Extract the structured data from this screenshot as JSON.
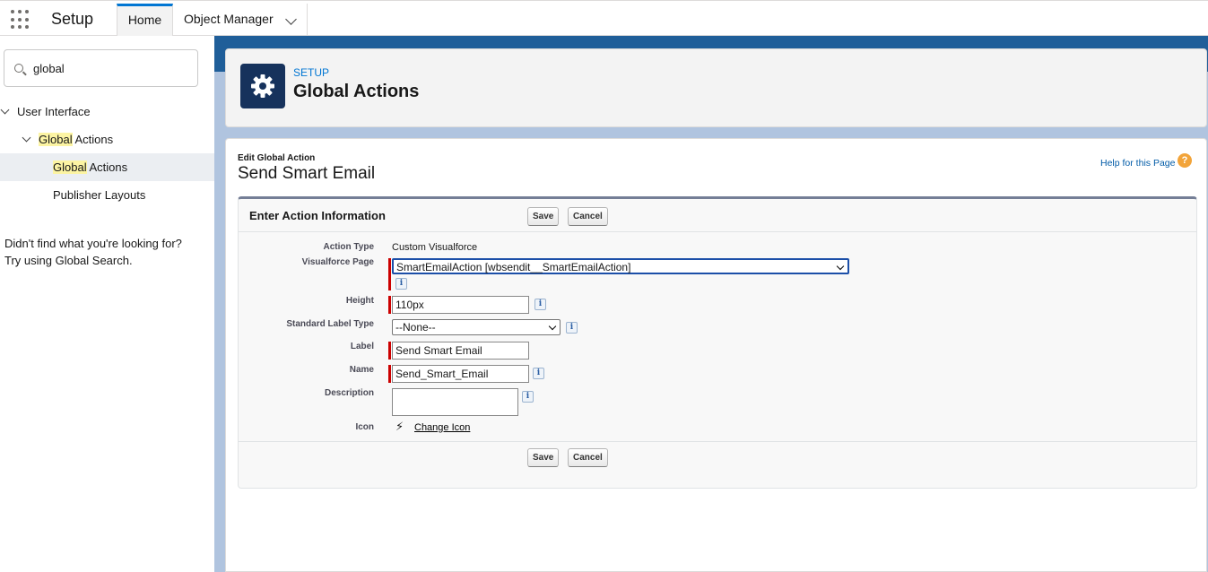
{
  "nav": {
    "app_name": "Setup",
    "tabs": [
      {
        "label": "Home"
      },
      {
        "label": "Object Manager"
      }
    ]
  },
  "sidebar": {
    "search_value": "global",
    "tree": {
      "user_interface": "User Interface",
      "global_actions_parent_hl": "Global",
      "global_actions_parent_rest": " Actions",
      "global_actions_child_hl": "Global",
      "global_actions_child_rest": " Actions",
      "publisher_layouts": "Publisher Layouts"
    },
    "not_found_line1": "Didn't find what you're looking for?",
    "not_found_line2": "Try using Global Search."
  },
  "header": {
    "breadcrumb": "SETUP",
    "title": "Global Actions"
  },
  "form": {
    "subtitle": "Edit Global Action",
    "title": "Send Smart Email",
    "help_link": "Help for this Page",
    "help_icon": "?",
    "section_title": "Enter Action Information",
    "save_label": "Save",
    "cancel_label": "Cancel",
    "fields": {
      "action_type_label": "Action Type",
      "action_type_value": "Custom Visualforce",
      "visualforce_label": "Visualforce Page",
      "visualforce_value": "SmartEmailAction [wbsendit__SmartEmailAction]",
      "height_label": "Height",
      "height_value": "110px",
      "std_label_type_label": "Standard Label Type",
      "std_label_type_value": "--None--",
      "label_label": "Label",
      "label_value": "Send Smart Email",
      "name_label": "Name",
      "name_value": "Send_Smart_Email",
      "description_label": "Description",
      "description_value": "",
      "icon_label": "Icon",
      "change_icon": "Change Icon"
    },
    "info_glyph": "i"
  }
}
